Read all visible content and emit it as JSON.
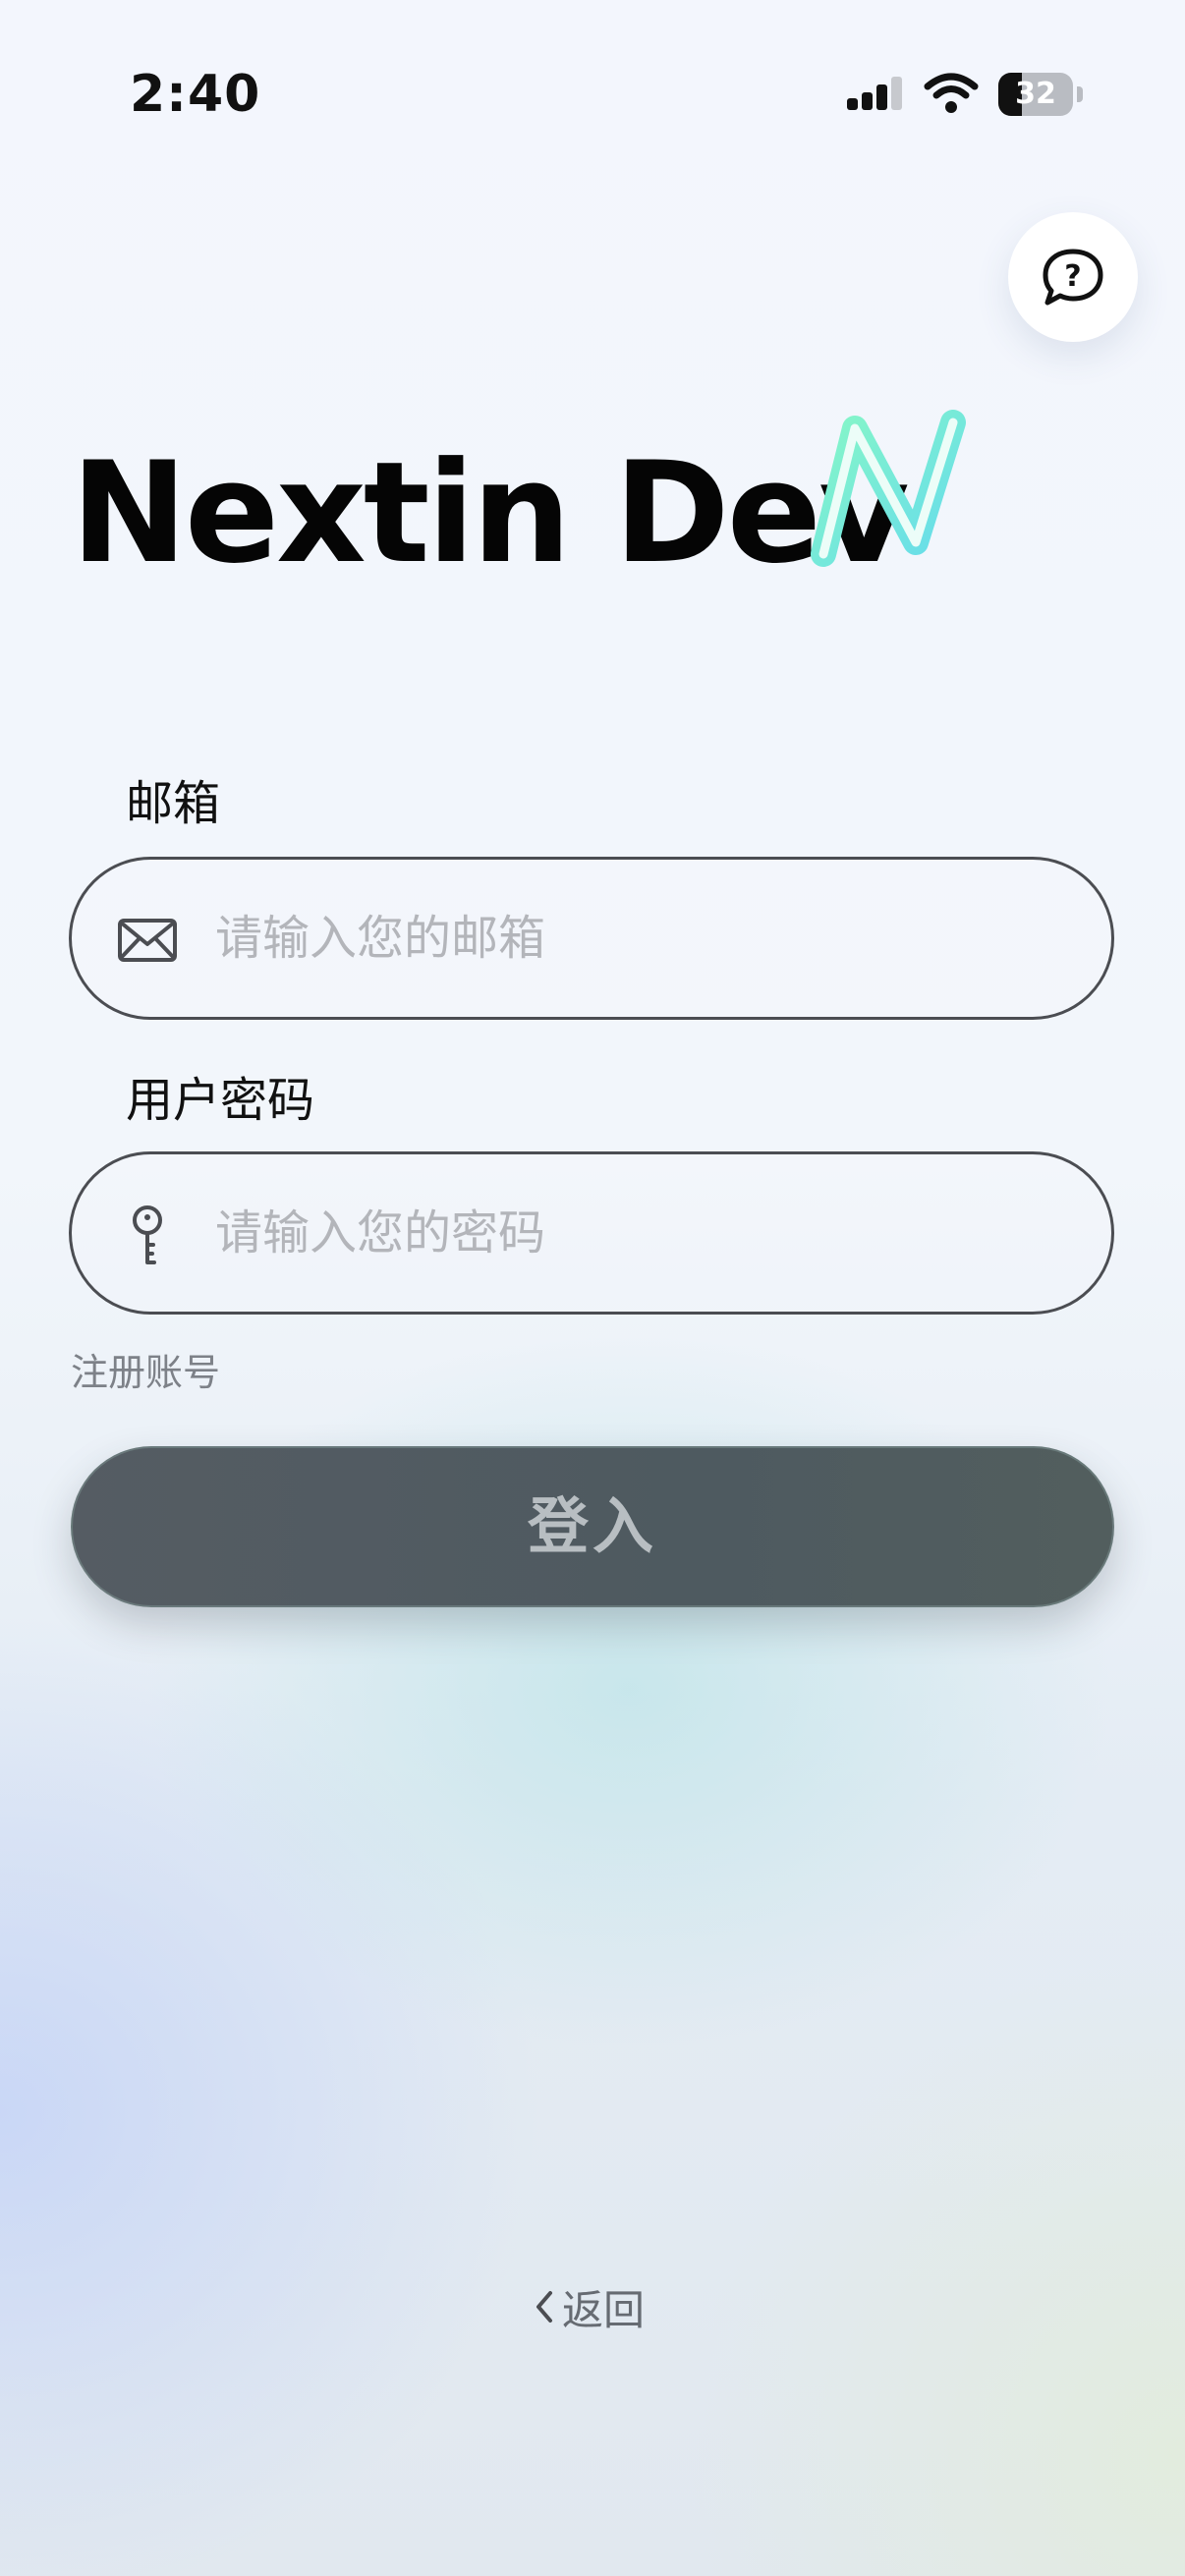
{
  "status_bar": {
    "time": "2:40",
    "battery_level": "32",
    "battery_fraction": 0.32
  },
  "help": {
    "icon": "help-chat-icon"
  },
  "app": {
    "title": "Nextin Dev",
    "logo_colors": [
      "#7df5cf",
      "#6fe4ea"
    ]
  },
  "form": {
    "email_label": "邮箱",
    "email_placeholder": "请输入您的邮箱",
    "email_value": "",
    "password_label": "用户密码",
    "password_placeholder": "请输入您的密码",
    "password_value": "",
    "register_label": "注册账号",
    "login_label": "登入"
  },
  "navigation": {
    "back_label": "返回"
  },
  "colors": {
    "input_border": "#4b4d52",
    "login_button": "#525b62",
    "placeholder": "#b3b5ba"
  }
}
